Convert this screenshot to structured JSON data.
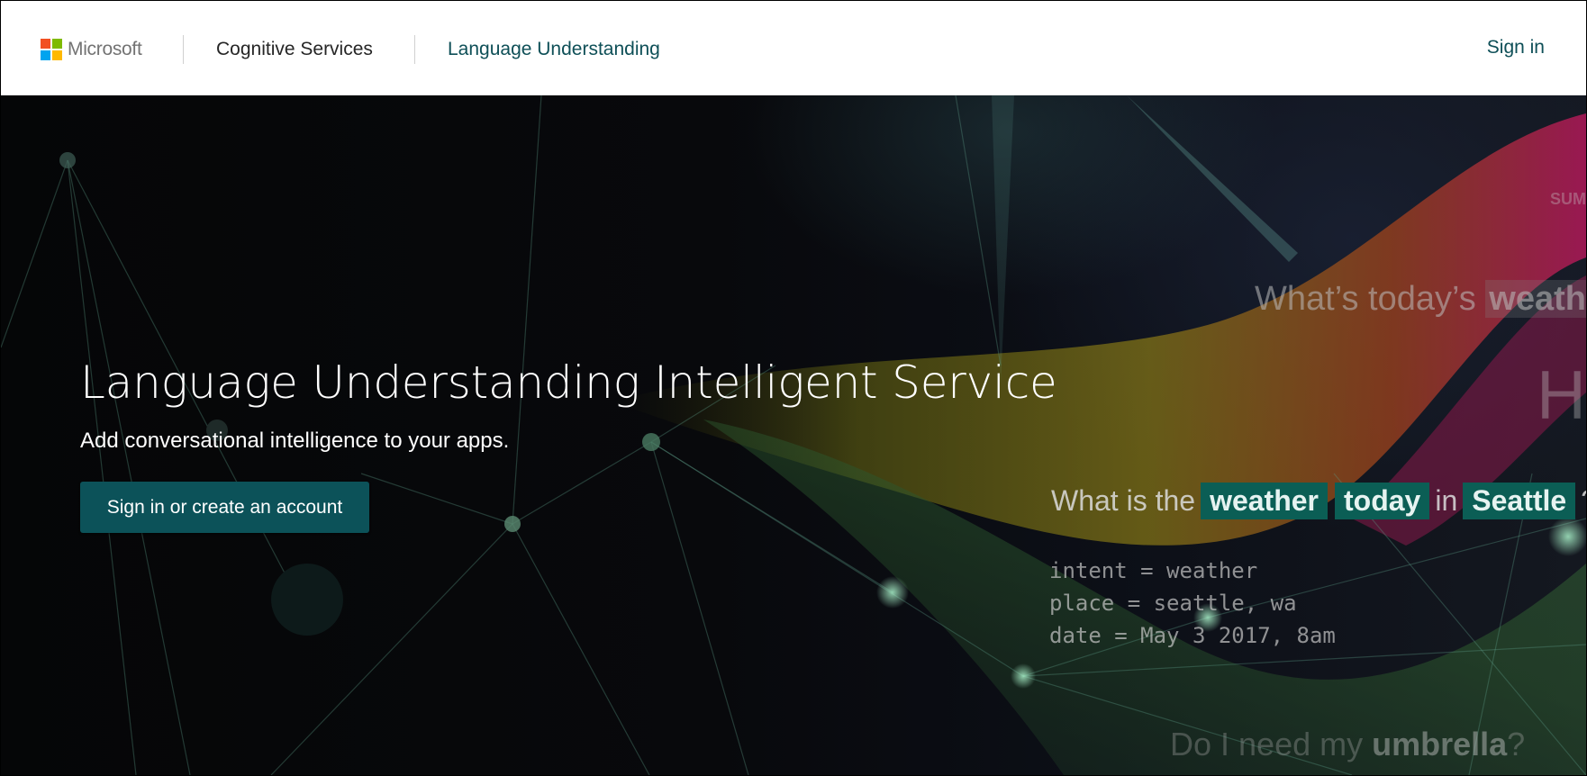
{
  "header": {
    "brand": "Microsoft",
    "nav": [
      {
        "label": "Cognitive Services"
      },
      {
        "label": "Language Understanding"
      }
    ],
    "signin_label": "Sign in"
  },
  "hero": {
    "title": "Language Understanding Intelligent Service",
    "subtitle": "Add conversational intelligence to your apps.",
    "cta_label": "Sign in or create an account"
  },
  "illustration": {
    "question1": {
      "prefix": "What’s today’s",
      "highlight": "weathe"
    },
    "fragment_big": "H",
    "fragment_small": "SUM",
    "question2": {
      "prefix": "What is the",
      "tag1": "weather",
      "tag2": "today",
      "middle": "in",
      "tag3": "Seattle",
      "suffix": "?"
    },
    "code_lines": [
      "intent = weather",
      "place = seattle, wa",
      "date = May 3 2017, 8am"
    ],
    "question3": {
      "prefix": "Do I need my",
      "highlight": "umbrella",
      "suffix": "?"
    }
  },
  "colors": {
    "accent": "#0e4f57",
    "cta_bg": "#0c5259",
    "tag_bg": "#0b5e55",
    "ms_red": "#f25022",
    "ms_green": "#7fba00",
    "ms_blue": "#00a4ef",
    "ms_yellow": "#ffb900"
  },
  "icons": [
    "microsoft-logo-icon"
  ]
}
